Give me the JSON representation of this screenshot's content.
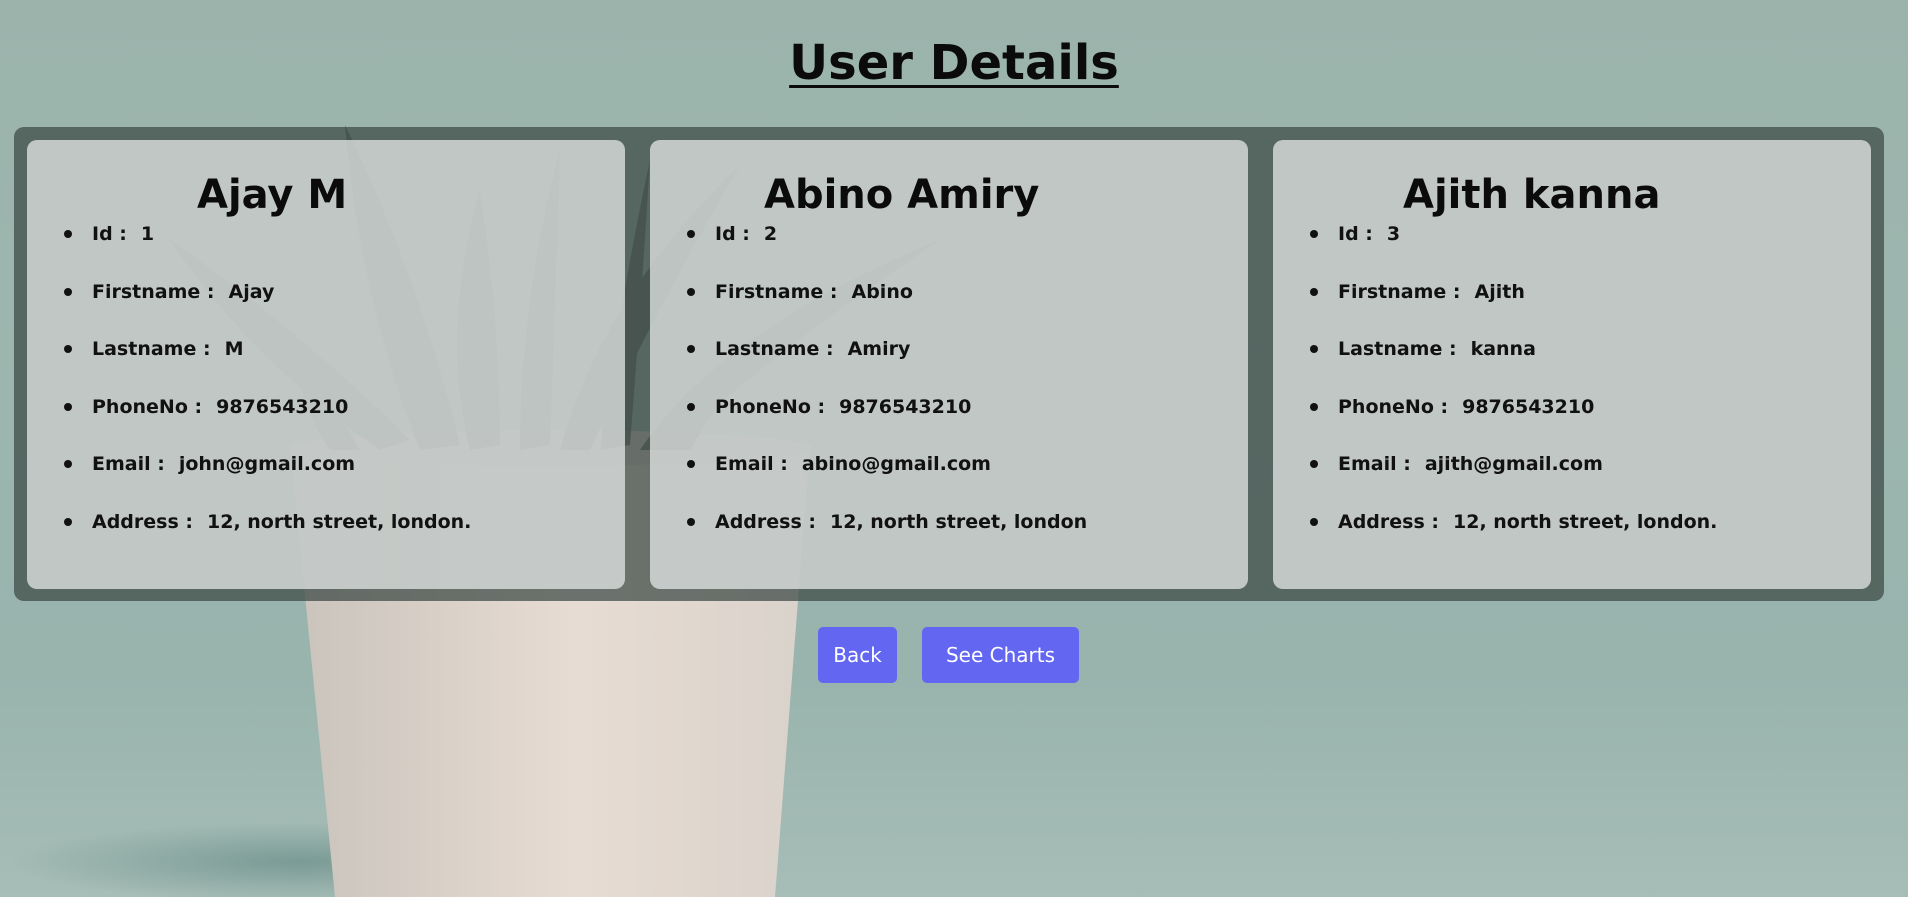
{
  "page": {
    "title": "User Details"
  },
  "colors": {
    "background": "#9bb3ab",
    "panel": "#3c4844",
    "card": "#dce0de",
    "button": "#6366f1",
    "button_text": "#ffffff",
    "text": "#0b0b0b"
  },
  "users": [
    {
      "name": "Ajay M",
      "fields": [
        {
          "label": "Id :",
          "value": "1"
        },
        {
          "label": "Firstname :",
          "value": "Ajay"
        },
        {
          "label": "Lastname :",
          "value": "M"
        },
        {
          "label": "PhoneNo :",
          "value": "9876543210"
        },
        {
          "label": "Email :",
          "value": "john@gmail.com"
        },
        {
          "label": "Address :",
          "value": "12, north street, london."
        }
      ]
    },
    {
      "name": "Abino Amiry",
      "fields": [
        {
          "label": "Id :",
          "value": "2"
        },
        {
          "label": "Firstname :",
          "value": "Abino"
        },
        {
          "label": "Lastname :",
          "value": "Amiry"
        },
        {
          "label": "PhoneNo :",
          "value": "9876543210"
        },
        {
          "label": "Email :",
          "value": "abino@gmail.com"
        },
        {
          "label": "Address :",
          "value": "12, north street, london"
        }
      ]
    },
    {
      "name": "Ajith kanna",
      "fields": [
        {
          "label": "Id :",
          "value": "3"
        },
        {
          "label": "Firstname :",
          "value": "Ajith"
        },
        {
          "label": "Lastname :",
          "value": "kanna"
        },
        {
          "label": "PhoneNo :",
          "value": "9876543210"
        },
        {
          "label": "Email :",
          "value": "ajith@gmail.com"
        },
        {
          "label": "Address :",
          "value": "12, north street, london."
        }
      ]
    }
  ],
  "actions": {
    "back_label": "Back",
    "charts_label": "See Charts"
  }
}
